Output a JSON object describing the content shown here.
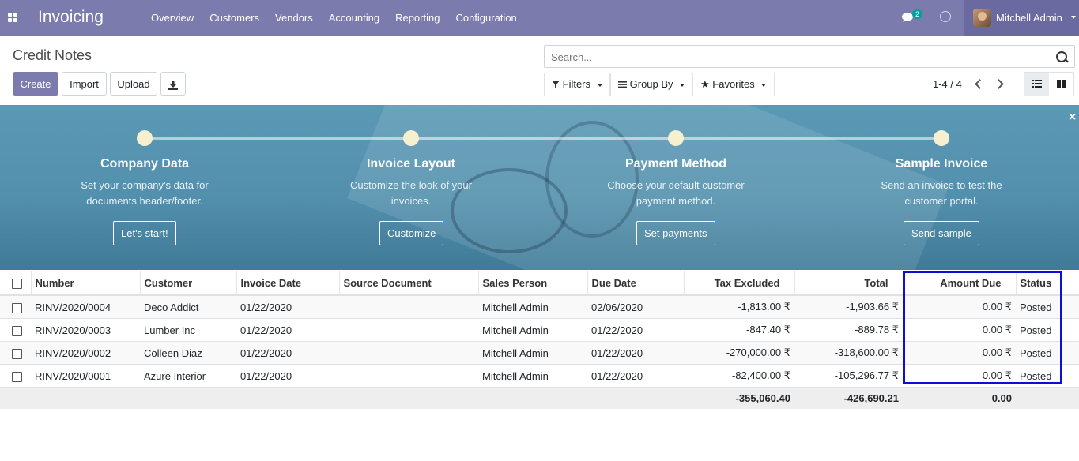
{
  "navbar": {
    "app_name": "Invoicing",
    "menu": [
      "Overview",
      "Customers",
      "Vendors",
      "Accounting",
      "Reporting",
      "Configuration"
    ],
    "chat_count": "2",
    "user_name": "Mitchell Admin",
    "color": "#7c7bad"
  },
  "control": {
    "breadcrumb": "Credit Notes",
    "buttons": {
      "create": "Create",
      "import": "Import",
      "upload": "Upload"
    },
    "search_placeholder": "Search...",
    "filters": "Filters",
    "group_by": "Group By",
    "favorites": "Favorites",
    "pager": "1-4 / 4"
  },
  "banner": {
    "steps": [
      {
        "title": "Company Data",
        "desc": "Set your company's data for documents header/footer.",
        "button": "Let's start!"
      },
      {
        "title": "Invoice Layout",
        "desc": "Customize the look of your invoices.",
        "button": "Customize"
      },
      {
        "title": "Payment Method",
        "desc": "Choose your default customer payment method.",
        "button": "Set payments"
      },
      {
        "title": "Sample Invoice",
        "desc": "Send an invoice to test the customer portal.",
        "button": "Send sample"
      }
    ],
    "close": "×"
  },
  "table": {
    "columns": {
      "number": "Number",
      "customer": "Customer",
      "invoice_date": "Invoice Date",
      "source": "Source Document",
      "sales_person": "Sales Person",
      "due_date": "Due Date",
      "tax_excluded": "Tax Excluded",
      "total": "Total",
      "amount_due": "Amount Due",
      "status": "Status"
    },
    "rows": [
      {
        "number": "RINV/2020/0004",
        "customer": "Deco Addict",
        "invoice_date": "01/22/2020",
        "source": "",
        "sales_person": "Mitchell Admin",
        "due_date": "02/06/2020",
        "tax_excluded": "-1,813.00 ₹",
        "total": "-1,903.66 ₹",
        "amount_due": "0.00 ₹",
        "status": "Posted"
      },
      {
        "number": "RINV/2020/0003",
        "customer": "Lumber Inc",
        "invoice_date": "01/22/2020",
        "source": "",
        "sales_person": "Mitchell Admin",
        "due_date": "01/22/2020",
        "tax_excluded": "-847.40 ₹",
        "total": "-889.78 ₹",
        "amount_due": "0.00 ₹",
        "status": "Posted"
      },
      {
        "number": "RINV/2020/0002",
        "customer": "Colleen Diaz",
        "invoice_date": "01/22/2020",
        "source": "",
        "sales_person": "Mitchell Admin",
        "due_date": "01/22/2020",
        "tax_excluded": "-270,000.00 ₹",
        "total": "-318,600.00 ₹",
        "amount_due": "0.00 ₹",
        "status": "Posted"
      },
      {
        "number": "RINV/2020/0001",
        "customer": "Azure Interior",
        "invoice_date": "01/22/2020",
        "source": "",
        "sales_person": "Mitchell Admin",
        "due_date": "01/22/2020",
        "tax_excluded": "-82,400.00 ₹",
        "total": "-105,296.77 ₹",
        "amount_due": "0.00 ₹",
        "status": "Posted"
      }
    ],
    "totals": {
      "tax_excluded": "-355,060.40",
      "total": "-426,690.21",
      "amount_due": "0.00"
    },
    "highlight_color": "#0a0fd1"
  }
}
